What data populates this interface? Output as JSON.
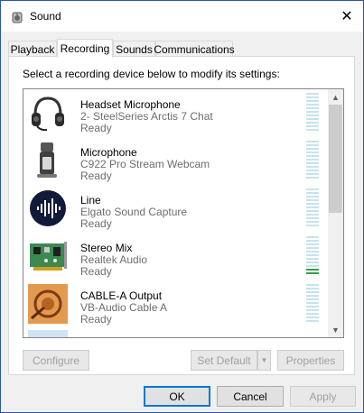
{
  "window": {
    "title": "Sound",
    "close_glyph": "✕"
  },
  "tabs": [
    {
      "label": "Playback",
      "active": false
    },
    {
      "label": "Recording",
      "active": true
    },
    {
      "label": "Sounds",
      "active": false
    },
    {
      "label": "Communications",
      "active": false
    }
  ],
  "panel": {
    "instruction": "Select a recording device below to modify its settings:"
  },
  "devices": [
    {
      "name": "Headset Microphone",
      "description": "2- SteelSeries Arctis 7 Chat",
      "status": "Ready",
      "icon": "headset-icon",
      "level": 0
    },
    {
      "name": "Microphone",
      "description": "C922 Pro Stream Webcam",
      "status": "Ready",
      "icon": "webcam-icon",
      "level": 0
    },
    {
      "name": "Line",
      "description": "Elgato Sound Capture",
      "status": "Ready",
      "icon": "waveform-icon",
      "level": 0
    },
    {
      "name": "Stereo Mix",
      "description": "Realtek Audio",
      "status": "Ready",
      "icon": "sound-card-icon",
      "level": 2
    },
    {
      "name": "CABLE-A Output",
      "description": "VB-Audio Cable A",
      "status": "Ready",
      "icon": "cable-icon",
      "level": 0
    }
  ],
  "panel_buttons": {
    "configure": "Configure",
    "set_default": "Set Default",
    "properties": "Properties"
  },
  "footer": {
    "ok": "OK",
    "cancel": "Cancel",
    "apply": "Apply"
  },
  "colors": {
    "accent": "#0078d7",
    "meter_idle": "#c7e3ee",
    "meter_active": "#33a04a"
  }
}
